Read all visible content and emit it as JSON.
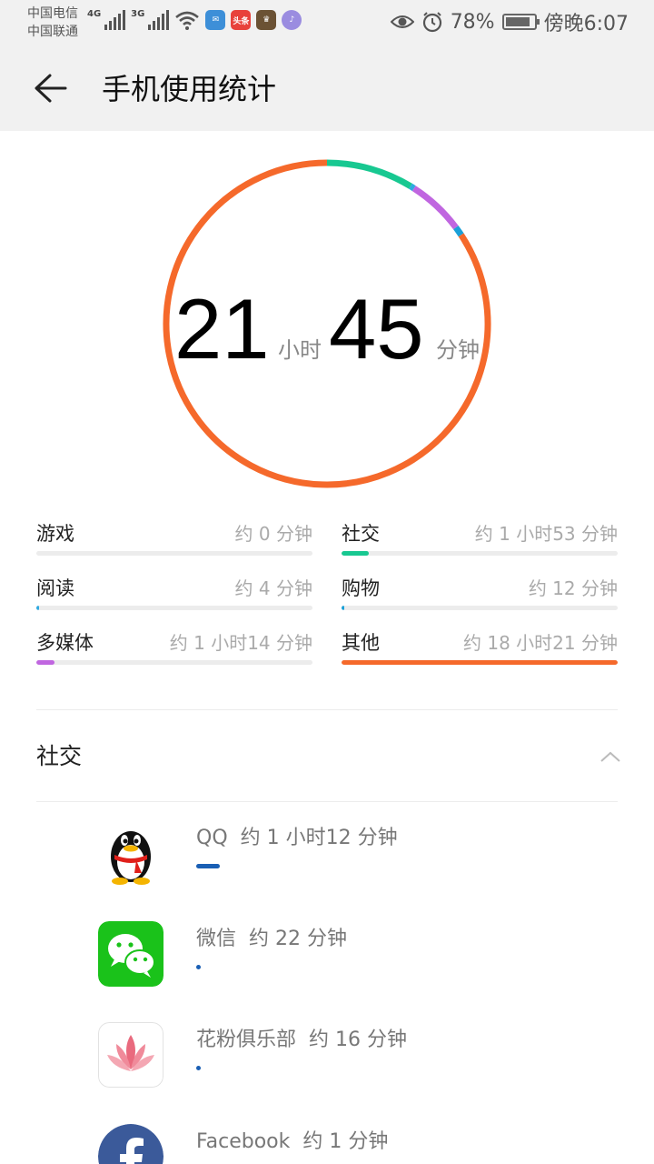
{
  "status_bar": {
    "carrier_1": "中国电信",
    "carrier_2": "中国联通",
    "net_1": "4G",
    "net_2": "3G",
    "app_badge_toutiao": "头条",
    "battery_percent": "78%",
    "time": "傍晚6:07",
    "icons": [
      "signal-icon",
      "wifi-icon",
      "eye-icon",
      "alarm-icon",
      "battery-icon"
    ]
  },
  "header": {
    "title": "手机使用统计",
    "back_icon": "back-arrow-icon"
  },
  "total": {
    "hours": "21",
    "hours_unit": "小时",
    "minutes": "45",
    "minutes_unit": "分钟"
  },
  "ring_segments": [
    {
      "category": "社交",
      "color": "#18c891",
      "fraction": 0.087
    },
    {
      "category": "阅读",
      "color": "#2fa9e0",
      "fraction": 0.004
    },
    {
      "category": "多媒体",
      "color": "#c066e0",
      "fraction": 0.057
    },
    {
      "category": "购物",
      "color": "#1aa0d8",
      "fraction": 0.009
    },
    {
      "category": "其他",
      "color": "#f5692b",
      "fraction": 0.843
    }
  ],
  "categories": [
    {
      "name": "游戏",
      "value": "约 0 分钟",
      "color": "#f5692b",
      "fraction": 0.0
    },
    {
      "name": "社交",
      "value": "约 1 小时53 分钟",
      "color": "#18c891",
      "fraction": 0.1
    },
    {
      "name": "阅读",
      "value": "约 4 分钟",
      "color": "#2fa9e0",
      "fraction": 0.004
    },
    {
      "name": "购物",
      "value": "约 12 分钟",
      "color": "#1aa0d8",
      "fraction": 0.011
    },
    {
      "name": "多媒体",
      "value": "约 1 小时14 分钟",
      "color": "#c066e0",
      "fraction": 0.066
    },
    {
      "name": "其他",
      "value": "约 18 小时21 分钟",
      "color": "#f5692b",
      "fraction": 1.0
    }
  ],
  "section": {
    "title": "社交",
    "collapse_icon": "chevron-up-icon"
  },
  "apps": [
    {
      "name": "QQ",
      "usage": "约 1 小时12 分钟",
      "icon": "qq-penguin-icon",
      "fraction": 0.082
    },
    {
      "name": "微信",
      "usage": "约 22 分钟",
      "icon": "wechat-icon",
      "fraction": 0.01
    },
    {
      "name": "花粉俱乐部",
      "usage": "约 16 分钟",
      "icon": "lotus-icon",
      "fraction": 0.008
    },
    {
      "name": "Facebook",
      "usage": "约 1 分钟",
      "icon": "facebook-icon",
      "fraction": 0.002
    }
  ]
}
